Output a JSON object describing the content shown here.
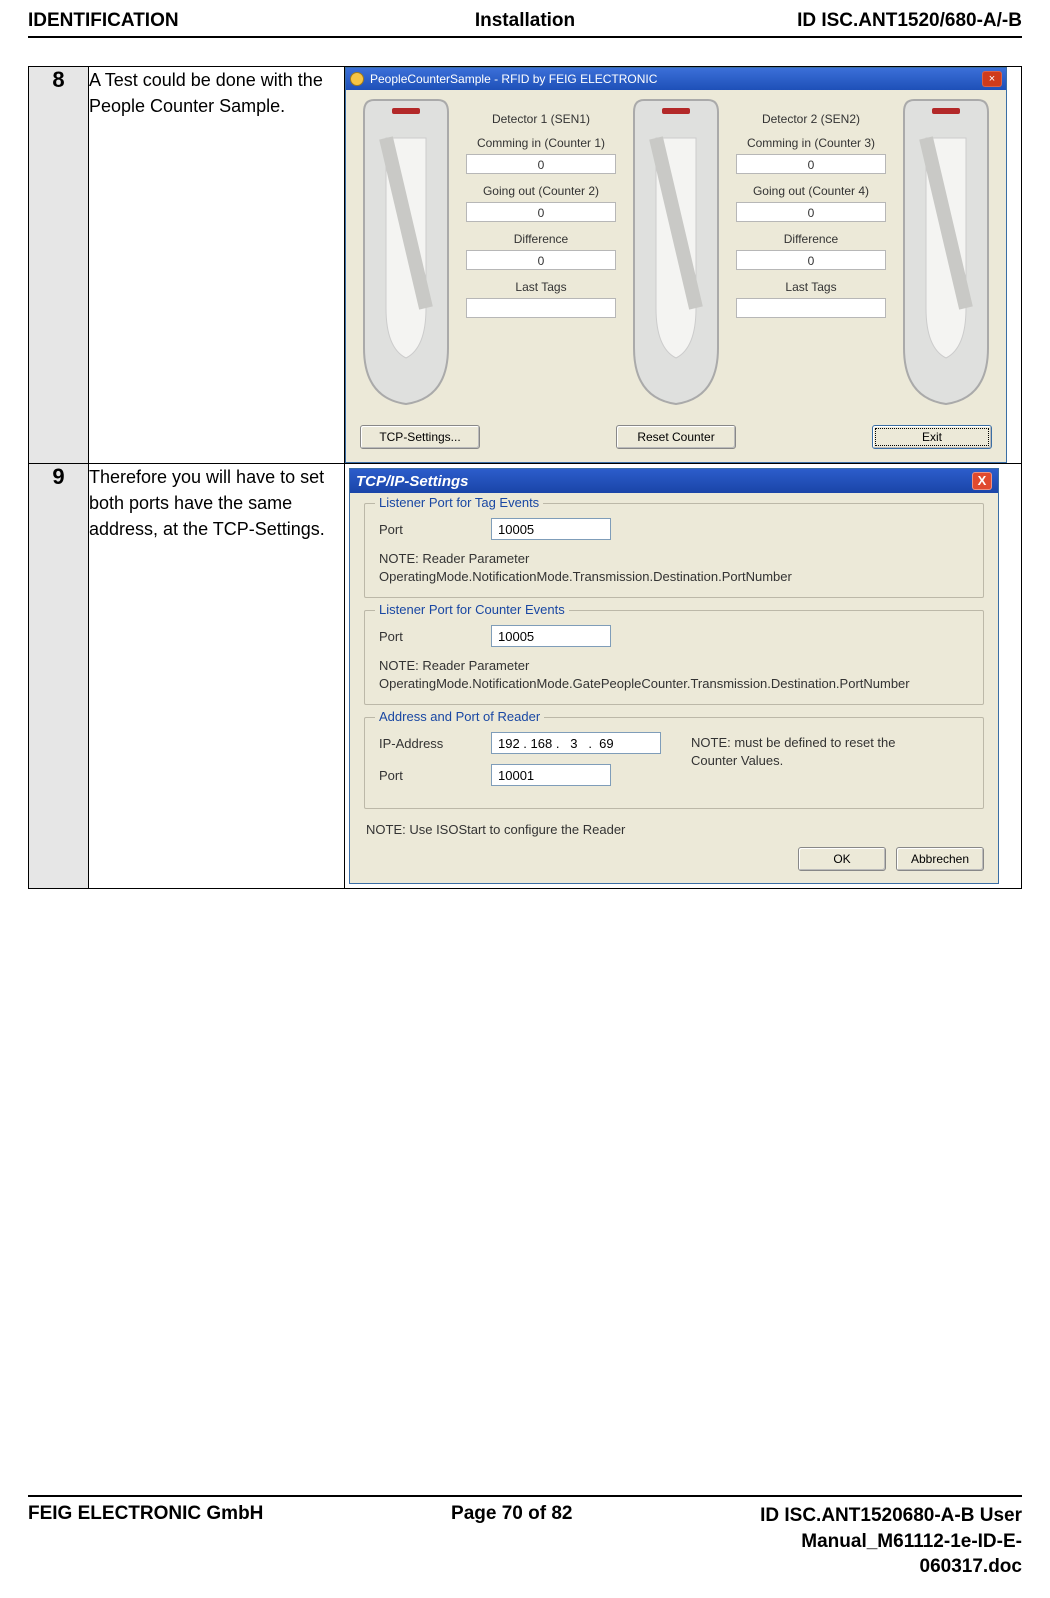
{
  "header": {
    "left": "IDENTIFICATION",
    "center": "Installation",
    "right": "ID ISC.ANT1520/680-A/-B"
  },
  "rows": {
    "8": {
      "num": "8",
      "desc": "A Test could be done with the People Counter Sample.",
      "app": {
        "title": "PeopleCounterSample - RFID by FEIG ELECTRONIC",
        "det1": {
          "title": "Detector 1 (SEN1)",
          "in_label": "Comming in (Counter 1)",
          "in_val": "0",
          "out_label": "Going out (Counter 2)",
          "out_val": "0",
          "diff_label": "Difference",
          "diff_val": "0",
          "last_label": "Last Tags"
        },
        "det2": {
          "title": "Detector 2 (SEN2)",
          "in_label": "Comming in (Counter 3)",
          "in_val": "0",
          "out_label": "Going out (Counter 4)",
          "out_val": "0",
          "diff_label": "Difference",
          "diff_val": "0",
          "last_label": "Last Tags"
        },
        "buttons": {
          "tcp": "TCP-Settings...",
          "reset": "Reset Counter",
          "exit": "Exit"
        }
      }
    },
    "9": {
      "num": "9",
      "desc": "Therefore you will have to set both ports have the same address, at the TCP-Settings.",
      "dlg": {
        "title": "TCP/IP-Settings",
        "g1": {
          "legend": "Listener Port for Tag Events",
          "port_label": "Port",
          "port_val": "10005",
          "note": "NOTE: Reader Parameter\nOperatingMode.NotificationMode.Transmission.Destination.PortNumber"
        },
        "g2": {
          "legend": "Listener Port for Counter Events",
          "port_label": "Port",
          "port_val": "10005",
          "note": "NOTE: Reader Parameter\nOperatingMode.NotificationMode.GatePeopleCounter.Transmission.Destination.PortNumber"
        },
        "g3": {
          "legend": "Address and Port of Reader",
          "ip_label": "IP-Address",
          "ip_val": "192 . 168 .   3   .  69",
          "port_label": "Port",
          "port_val": "10001",
          "sidenote": "NOTE: must be defined to reset the Counter Values."
        },
        "footnote": "NOTE: Use ISOStart to configure the Reader",
        "ok": "OK",
        "cancel": "Abbrechen"
      }
    }
  },
  "footer": {
    "left": "FEIG ELECTRONIC GmbH",
    "center": "Page 70 of 82",
    "r1": "ID ISC.ANT1520680-A-B User",
    "r2": "Manual_M61112-1e-ID-E-",
    "r3": "060317.doc"
  }
}
